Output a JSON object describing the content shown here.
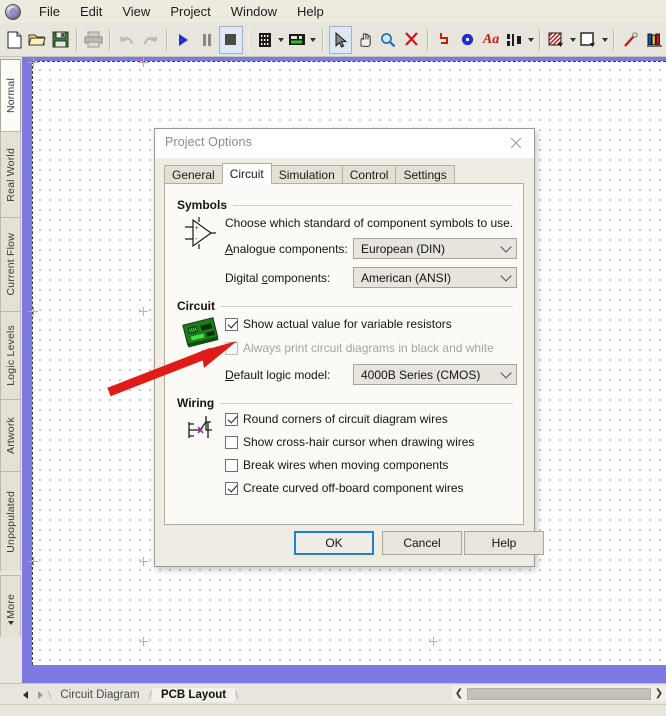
{
  "app": {
    "logo_icon": "app-logo-icon"
  },
  "menubar": {
    "items": [
      {
        "label": "File"
      },
      {
        "label": "Edit"
      },
      {
        "label": "View"
      },
      {
        "label": "Project"
      },
      {
        "label": "Window"
      },
      {
        "label": "Help"
      }
    ]
  },
  "toolbar": {
    "groups": [
      {
        "buttons": [
          {
            "name": "new-file-button",
            "icon": "new-document-icon"
          },
          {
            "name": "open-file-button",
            "icon": "open-folder-icon"
          },
          {
            "name": "save-file-button",
            "icon": "floppy-disk-icon"
          }
        ]
      },
      {
        "buttons": [
          {
            "name": "print-button",
            "icon": "printer-icon"
          }
        ]
      },
      {
        "buttons": [
          {
            "name": "undo-button",
            "icon": "undo-arrow-icon"
          },
          {
            "name": "redo-button",
            "icon": "redo-arrow-icon"
          }
        ]
      },
      {
        "buttons": [
          {
            "name": "run-simulation-button",
            "icon": "play-triangle-icon"
          },
          {
            "name": "pause-simulation-button",
            "icon": "pause-bars-icon"
          },
          {
            "name": "stop-simulation-button",
            "icon": "stop-square-icon"
          }
        ]
      },
      {
        "buttons": [
          {
            "name": "component-browser-button",
            "icon": "ic-chip-icon"
          },
          {
            "name": "component-browser-dropdown",
            "icon": "chevron-down-icon"
          },
          {
            "name": "pcb-board-button",
            "icon": "pcb-board-icon"
          },
          {
            "name": "pcb-board-dropdown",
            "icon": "chevron-down-icon"
          }
        ]
      },
      {
        "buttons": [
          {
            "name": "select-tool-button",
            "icon": "arrow-cursor-icon"
          },
          {
            "name": "pan-tool-button",
            "icon": "hand-icon"
          },
          {
            "name": "zoom-tool-button",
            "icon": "magnifier-icon"
          },
          {
            "name": "delete-tool-button",
            "icon": "red-x-icon"
          }
        ]
      },
      {
        "buttons": [
          {
            "name": "wire-tool-button",
            "icon": "wire-trace-icon"
          },
          {
            "name": "via-tool-button",
            "icon": "blue-via-dot-icon"
          },
          {
            "name": "text-tool-button",
            "icon": "text-aa-icon"
          },
          {
            "name": "align-tool-button",
            "icon": "align-icon"
          },
          {
            "name": "align-tool-dropdown",
            "icon": "chevron-down-icon"
          }
        ]
      },
      {
        "buttons": [
          {
            "name": "fill-tool-button",
            "icon": "hatched-fill-icon"
          },
          {
            "name": "fill-tool-dropdown",
            "icon": "chevron-down-icon"
          },
          {
            "name": "board-outline-button",
            "icon": "square-outline-icon"
          },
          {
            "name": "board-outline-dropdown",
            "icon": "chevron-down-icon"
          }
        ]
      },
      {
        "buttons": [
          {
            "name": "probe-tool-button",
            "icon": "probe-pen-icon"
          },
          {
            "name": "layers-button",
            "icon": "layer-books-icon"
          }
        ]
      }
    ]
  },
  "view_tabs": {
    "items": [
      {
        "label": "Normal",
        "selected": true
      },
      {
        "label": "Real World",
        "selected": false
      },
      {
        "label": "Current Flow",
        "selected": false
      },
      {
        "label": "Logic Levels",
        "selected": false
      },
      {
        "label": "Artwork",
        "selected": false
      },
      {
        "label": "Unpopulated",
        "selected": false
      },
      {
        "label": "More",
        "selected": false,
        "has_caret": true
      }
    ]
  },
  "dialog": {
    "title": "Project Options",
    "close_icon": "close-x-icon",
    "tabs": [
      {
        "label": "General",
        "selected": false
      },
      {
        "label": "Circuit",
        "selected": true
      },
      {
        "label": "Simulation",
        "selected": false
      },
      {
        "label": "Control",
        "selected": false
      },
      {
        "label": "Settings",
        "selected": false
      }
    ],
    "symbols_group": {
      "title": "Symbols",
      "icon": "opamp-symbol-icon",
      "description": "Choose which standard of component symbols to use.",
      "fields": [
        {
          "name": "analogue-components",
          "label": "Analogue components:",
          "accesskey": "A",
          "value": "European (DIN)",
          "chevron_icon": "chevron-down-icon"
        },
        {
          "name": "digital-components",
          "label": "Digital components:",
          "accesskey": "c",
          "value": "American (ANSI)",
          "chevron_icon": "chevron-down-icon"
        }
      ]
    },
    "circuit_group": {
      "title": "Circuit",
      "icon": "pcb-board-icon",
      "checkboxes": [
        {
          "name": "show-actual-value-checkbox",
          "label": "Show actual value for variable resistors",
          "checked": true,
          "disabled": false
        },
        {
          "name": "always-print-bw-checkbox",
          "label": "Always print circuit diagrams in black and white",
          "checked": false,
          "disabled": true
        }
      ],
      "field": {
        "name": "default-logic-model",
        "label": "Default logic model:",
        "accesskey": "D",
        "value": "4000B Series (CMOS)",
        "chevron_icon": "chevron-down-icon"
      }
    },
    "wiring_group": {
      "title": "Wiring",
      "icon": "wire-junction-icon",
      "checkboxes": [
        {
          "name": "round-corners-checkbox",
          "label": "Round corners of circuit diagram wires",
          "checked": true,
          "disabled": false
        },
        {
          "name": "cross-hair-cursor-checkbox",
          "label": "Show cross-hair cursor when drawing wires",
          "checked": false,
          "disabled": false
        },
        {
          "name": "break-wires-checkbox",
          "label": "Break wires when moving components",
          "checked": false,
          "disabled": false
        },
        {
          "name": "curved-offboard-wires-checkbox",
          "label": "Create curved off-board component wires",
          "checked": true,
          "disabled": false
        }
      ]
    },
    "buttons": [
      {
        "name": "ok-button",
        "label": "OK",
        "focused": true
      },
      {
        "name": "cancel-button",
        "label": "Cancel",
        "focused": false
      },
      {
        "name": "help-button",
        "label": "Help",
        "focused": false
      }
    ]
  },
  "annotation": {
    "arrow_color": "#e01c18",
    "arrow_icon": "red-pointer-arrow-icon"
  },
  "sheet_tabs": {
    "prev_icon": "triangle-left-icon",
    "next_icon": "triangle-right-icon",
    "items": [
      {
        "label": "Circuit Diagram",
        "selected": false
      },
      {
        "label": "PCB Layout",
        "selected": true
      }
    ]
  },
  "scrollbar": {
    "left_arrow_icon": "chevron-left-icon",
    "right_arrow_icon": "chevron-right-icon"
  },
  "colors": {
    "canvas_border": "#7d7ae0",
    "app_background": "#e8e6dc",
    "focus_blue": "#1982d1",
    "annotation_red": "#e01c18"
  }
}
